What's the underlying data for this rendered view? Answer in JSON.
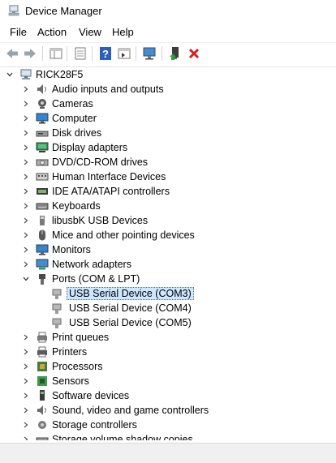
{
  "window": {
    "title": "Device Manager"
  },
  "menu": {
    "file": "File",
    "action": "Action",
    "view": "View",
    "help": "Help"
  },
  "tree": {
    "root": "RICK28F5",
    "categories": [
      "Audio inputs and outputs",
      "Cameras",
      "Computer",
      "Disk drives",
      "Display adapters",
      "DVD/CD-ROM drives",
      "Human Interface Devices",
      "IDE ATA/ATAPI controllers",
      "Keyboards",
      "libusbK USB Devices",
      "Mice and other pointing devices",
      "Monitors",
      "Network adapters",
      "Ports (COM & LPT)"
    ],
    "ports_children": [
      "USB Serial Device (COM3)",
      "USB Serial Device (COM4)",
      "USB Serial Device (COM5)"
    ],
    "categories_after": [
      "Print queues",
      "Printers",
      "Processors",
      "Sensors",
      "Software devices",
      "Sound, video and game controllers",
      "Storage controllers",
      "Storage volume shadow copies"
    ]
  }
}
